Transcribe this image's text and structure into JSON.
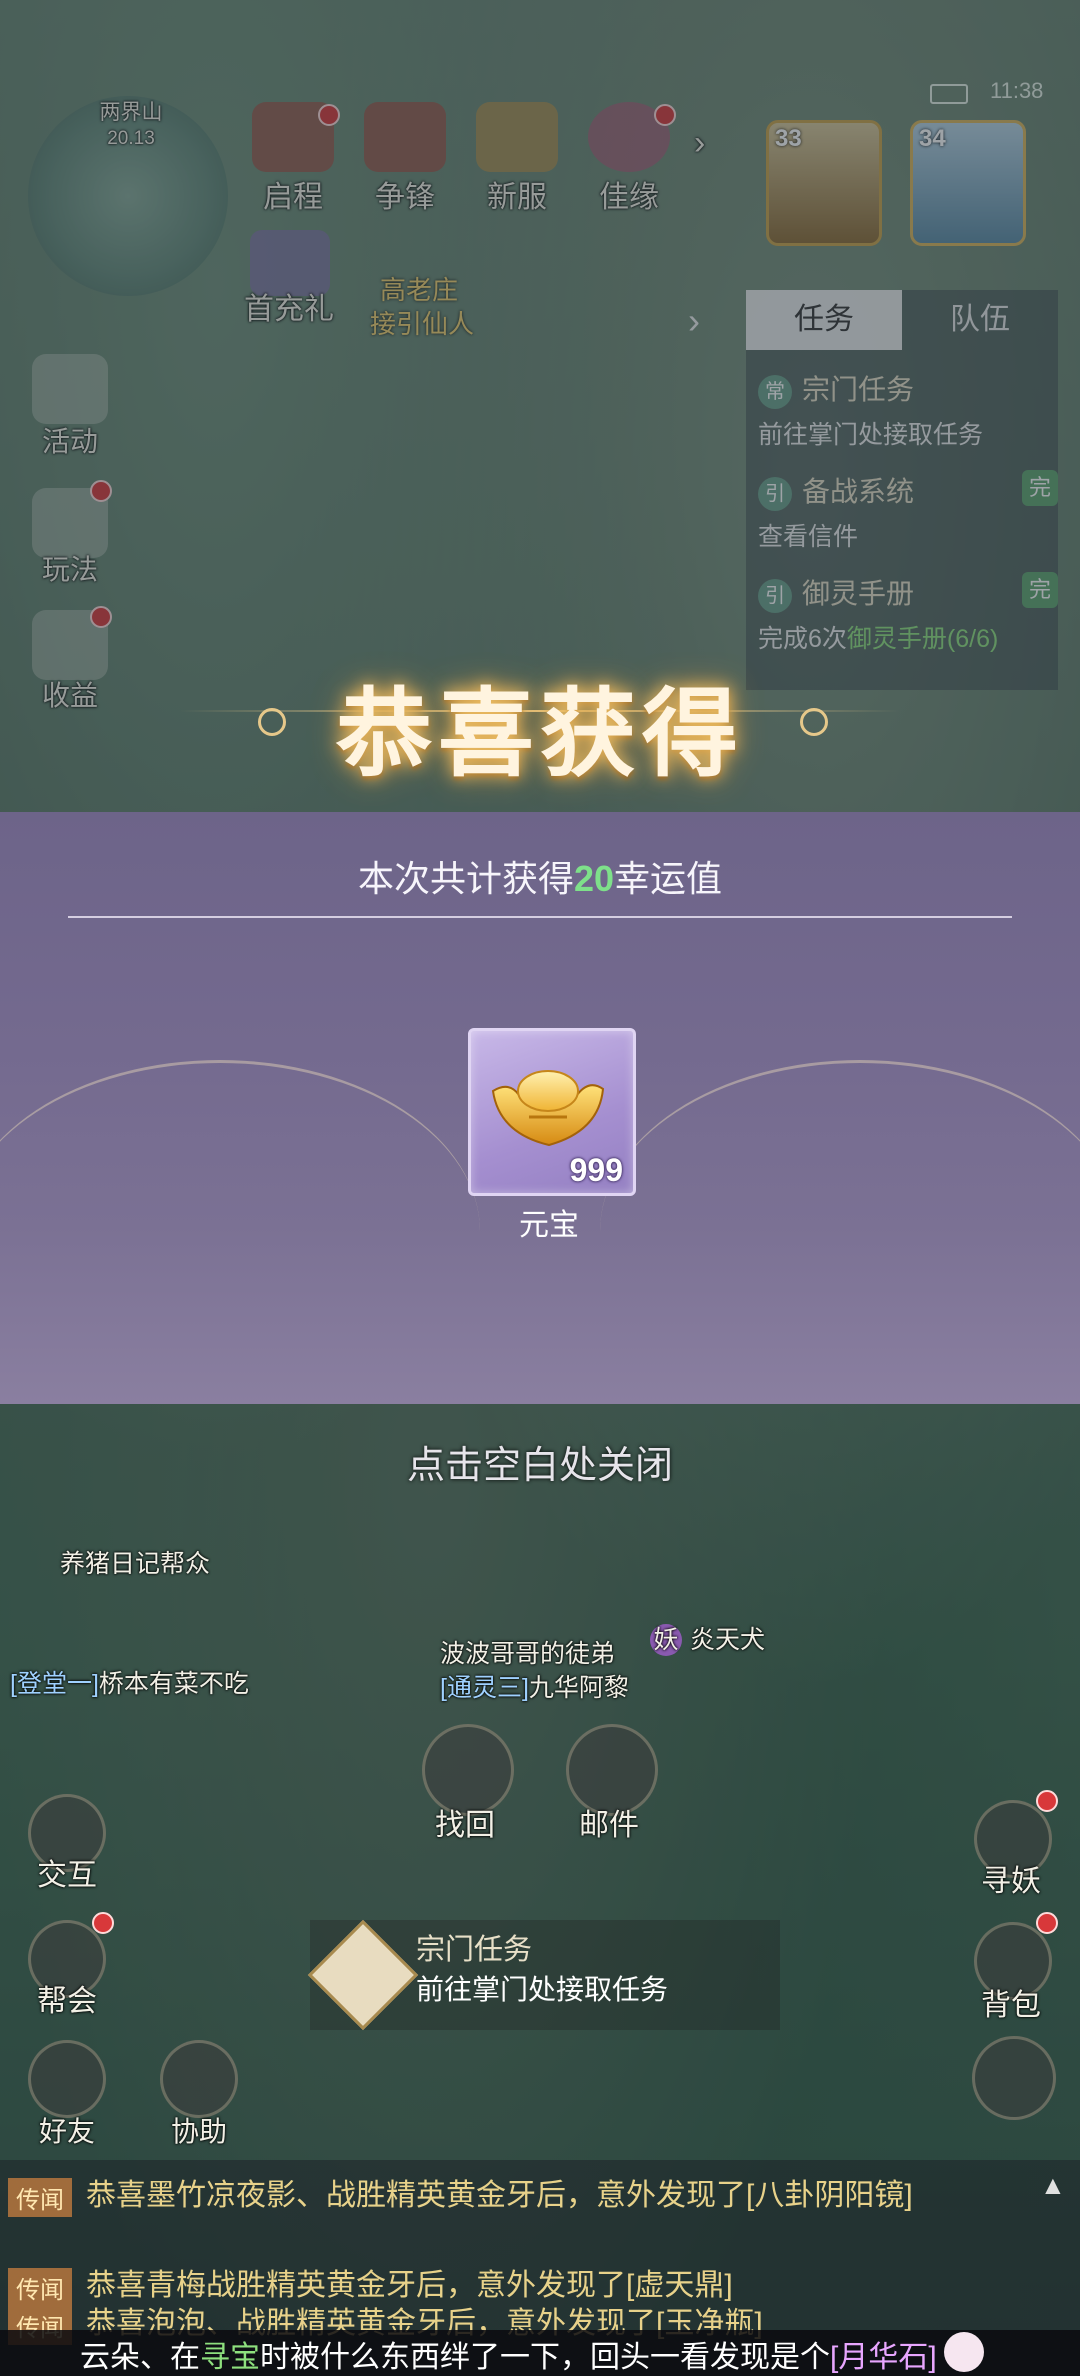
{
  "hud": {
    "map_name": "两界山",
    "map_time": "20.13",
    "time": "11:38",
    "top_buttons": [
      "启程",
      "争锋",
      "新服",
      "佳缘"
    ],
    "welfare_label": "首充礼",
    "portraits": [
      {
        "level": "33"
      },
      {
        "level": "34"
      }
    ],
    "npc_labels": [
      "高老庄",
      "接引仙人"
    ]
  },
  "task_panel": {
    "tabs": [
      "任务",
      "队伍"
    ],
    "tasks": [
      {
        "tag": "常",
        "title": "宗门任务",
        "desc": "前往掌门处接取任务"
      },
      {
        "tag": "引",
        "title": "备战系统",
        "desc": "查看信件",
        "done": "完"
      },
      {
        "tag": "引",
        "title": "御灵手册",
        "desc_pre": "完成6次",
        "desc_hl": "御灵手册(6/6)",
        "done": "完"
      }
    ]
  },
  "left_menu": [
    "活动",
    "玩法",
    "收益"
  ],
  "modal": {
    "title": "恭喜获得",
    "gain_prefix": "本次共计获得",
    "gain_number": "20",
    "gain_suffix": "幸运值",
    "item": {
      "name": "元宝",
      "count": "999",
      "icon": "gold-ingot-icon"
    },
    "close_hint": "点击空白处关闭"
  },
  "world": {
    "names": [
      {
        "guild": "",
        "name": "养猪日记帮众"
      },
      {
        "guild": "[登堂一]",
        "name": "桥本有菜不吃"
      },
      {
        "guild": "",
        "name": "波波哥哥的徒弟"
      },
      {
        "guild": "[通灵三]",
        "name": "九华阿黎"
      },
      {
        "guild": "妖",
        "name": "炎天犬"
      }
    ]
  },
  "mid_buttons": [
    "找回",
    "邮件"
  ],
  "quest_tracker": {
    "title": "宗门任务",
    "desc": "前往掌门处接取任务"
  },
  "right_buttons": [
    "寻妖",
    "背包"
  ],
  "bottom_left": [
    "交互",
    "帮会",
    "好友",
    "协助"
  ],
  "chat": {
    "lines": [
      {
        "tag": "传闻",
        "text": "恭喜墨竹凉夜影、战胜精英黄金牙后，意外发现了[八卦阴阳镜]"
      },
      {
        "tag": "传闻",
        "text": "恭喜青梅战胜精英黄金牙后，意外发现了[虚天鼎]"
      },
      {
        "tag": "传闻",
        "text": "恭喜泡泡、战胜精英黄金牙后，意外发现了[玉净瓶]"
      }
    ]
  },
  "ticker": {
    "pre": "云朵、在",
    "hl1": "寻宝",
    "mid": "时被什么东西绊了一下，回头一看发现是个",
    "hl2": "[月华石]"
  }
}
